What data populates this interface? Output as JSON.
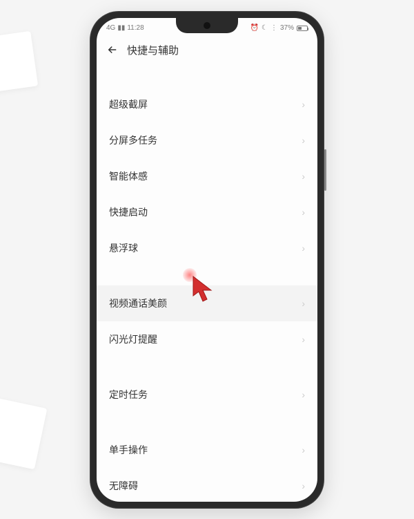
{
  "status": {
    "network": "4G",
    "signal": "▮▮",
    "time": "11:28",
    "battery_percent": "37%"
  },
  "header": {
    "title": "快捷与辅助"
  },
  "groups": [
    {
      "items": [
        {
          "label": "超级截屏",
          "highlighted": false
        },
        {
          "label": "分屏多任务",
          "highlighted": false
        },
        {
          "label": "智能体感",
          "highlighted": false
        },
        {
          "label": "快捷启动",
          "highlighted": false
        },
        {
          "label": "悬浮球",
          "highlighted": false
        }
      ]
    },
    {
      "items": [
        {
          "label": "视频通话美颜",
          "highlighted": true
        },
        {
          "label": "闪光灯提醒",
          "highlighted": false
        }
      ]
    },
    {
      "items": [
        {
          "label": "定时任务",
          "highlighted": false
        }
      ]
    },
    {
      "items": [
        {
          "label": "单手操作",
          "highlighted": false
        },
        {
          "label": "无障碍",
          "highlighted": false
        }
      ]
    }
  ]
}
